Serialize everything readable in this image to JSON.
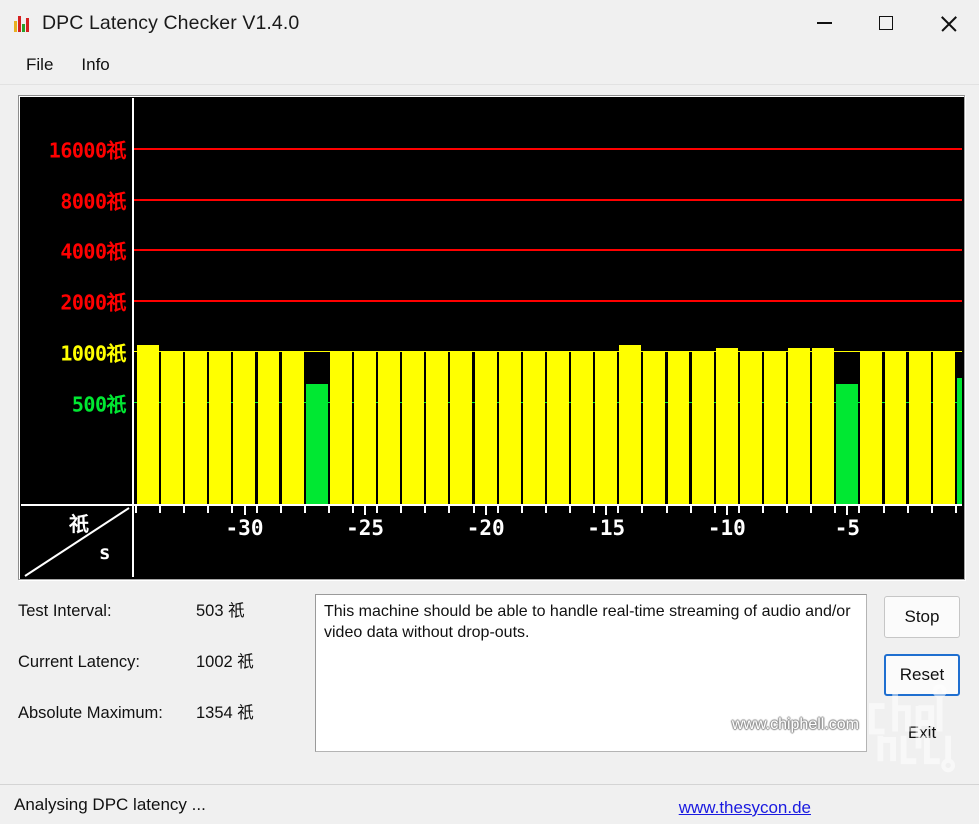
{
  "window": {
    "title": "DPC Latency Checker V1.4.0",
    "icon": "bar-chart-icon",
    "controls": {
      "minimize": "minimize-icon",
      "maximize": "maximize-icon",
      "close": "close-icon"
    }
  },
  "menu": {
    "items": [
      {
        "label": "File"
      },
      {
        "label": "Info"
      }
    ]
  },
  "chart_data": {
    "type": "bar",
    "title": "",
    "xlabel": "s",
    "ylabel": "祇",
    "unit_glyph": "祇",
    "ylim": [
      0,
      32000
    ],
    "y_scale": "log",
    "grid": true,
    "yticks": [
      {
        "value": 16000,
        "label": "16000祇",
        "color": "#ff0000"
      },
      {
        "value": 8000,
        "label": "8000祇",
        "color": "#ff0000"
      },
      {
        "value": 4000,
        "label": "4000祇",
        "color": "#ff0000"
      },
      {
        "value": 2000,
        "label": "2000祇",
        "color": "#ff0000"
      },
      {
        "value": 1000,
        "label": "1000祇",
        "color": "#ffff00"
      },
      {
        "value": 500,
        "label": "500祇",
        "color": "#00e832"
      }
    ],
    "xticks": [
      -30,
      -25,
      -20,
      -15,
      -10,
      -5
    ],
    "xticklabels": [
      "-30",
      "-25",
      "-20",
      "-15",
      "-10",
      "-5"
    ],
    "bar_color_normal": "#ffff00",
    "bar_color_low": "#00e832",
    "background": "#000000",
    "categories": [
      -34,
      -33,
      -32,
      -31,
      -30,
      -29,
      -28,
      -27,
      -26,
      -25,
      -24,
      -23,
      -22,
      -21,
      -20,
      -19,
      -18,
      -17,
      -16,
      -15,
      -14,
      -13,
      -12,
      -11,
      -10,
      -9,
      -8,
      -7,
      -6,
      -5,
      -4,
      -3,
      -2,
      -1,
      0
    ],
    "values": [
      1090,
      1002,
      1002,
      1002,
      1002,
      1002,
      1002,
      640,
      1002,
      1002,
      1002,
      1002,
      1002,
      1002,
      1002,
      1002,
      1002,
      1002,
      1002,
      1002,
      1090,
      1002,
      1002,
      1002,
      1050,
      1002,
      1002,
      1050,
      1050,
      640,
      1002,
      1002,
      1002,
      1002,
      700
    ]
  },
  "stats": [
    {
      "label": "Test Interval:",
      "value": "503 祇"
    },
    {
      "label": "Current Latency:",
      "value": "1002 祇"
    },
    {
      "label": "Absolute Maximum:",
      "value": "1354 祇"
    }
  ],
  "message": "This machine should be able to handle real-time streaming of audio and/or video data without drop-outs.",
  "buttons": [
    {
      "label": "Stop",
      "focused": false,
      "ghost": false
    },
    {
      "label": "Reset",
      "focused": true,
      "ghost": false
    },
    {
      "label": "Exit",
      "focused": false,
      "ghost": true
    }
  ],
  "watermark": {
    "url_text": "www.chiphell.com",
    "logo_text": "chiphell"
  },
  "statusbar": {
    "text": "Analysing DPC latency ...",
    "link": "www.thesycon.de"
  }
}
